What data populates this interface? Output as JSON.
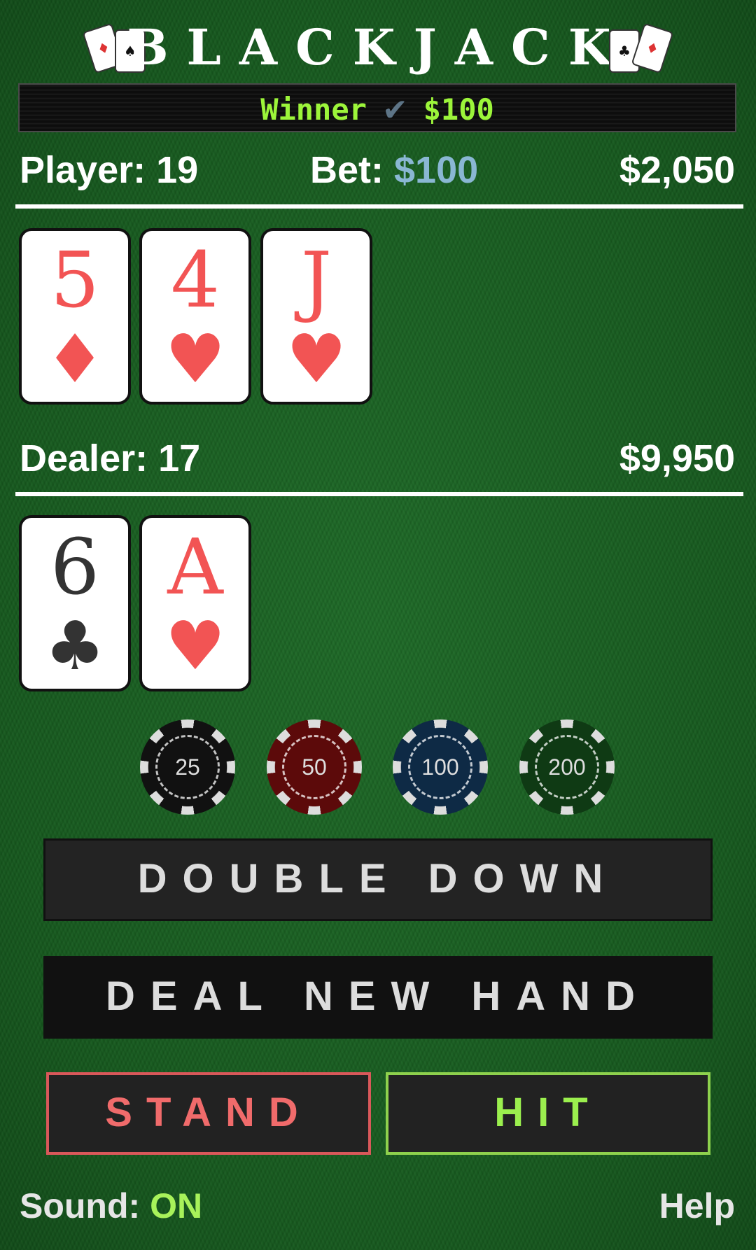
{
  "title": "BLACKJACK",
  "banner": {
    "result": "Winner",
    "check": "✔",
    "amount": "$100"
  },
  "player": {
    "label": "Player: 19",
    "bankroll": "$2,050"
  },
  "bet": {
    "label": "Bet:",
    "value": "$100"
  },
  "dealer": {
    "label": "Dealer: 17",
    "bankroll": "$9,950"
  },
  "player_cards": [
    {
      "rank": "5",
      "suit": "♦",
      "color": "#f25454"
    },
    {
      "rank": "4",
      "suit": "♥",
      "color": "#f25454"
    },
    {
      "rank": "J",
      "suit": "♥",
      "color": "#f25454"
    }
  ],
  "dealer_cards": [
    {
      "rank": "6",
      "suit": "♣",
      "color": "#333333"
    },
    {
      "rank": "A",
      "suit": "♥",
      "color": "#f25454"
    }
  ],
  "chips": [
    {
      "value": "25",
      "color": "#111111"
    },
    {
      "value": "50",
      "color": "#5c0a0a"
    },
    {
      "value": "100",
      "color": "#0e2a45"
    },
    {
      "value": "200",
      "color": "#0f3a14"
    }
  ],
  "buttons": {
    "double_down": "DOUBLE DOWN",
    "deal_new_hand": "DEAL NEW HAND",
    "stand": "STAND",
    "hit": "HIT"
  },
  "footer": {
    "sound_label": "Sound:",
    "sound_value": "ON",
    "help": "Help"
  },
  "icons": {
    "left_deco": "playing-cards-icon",
    "right_deco": "playing-cards-icon"
  }
}
